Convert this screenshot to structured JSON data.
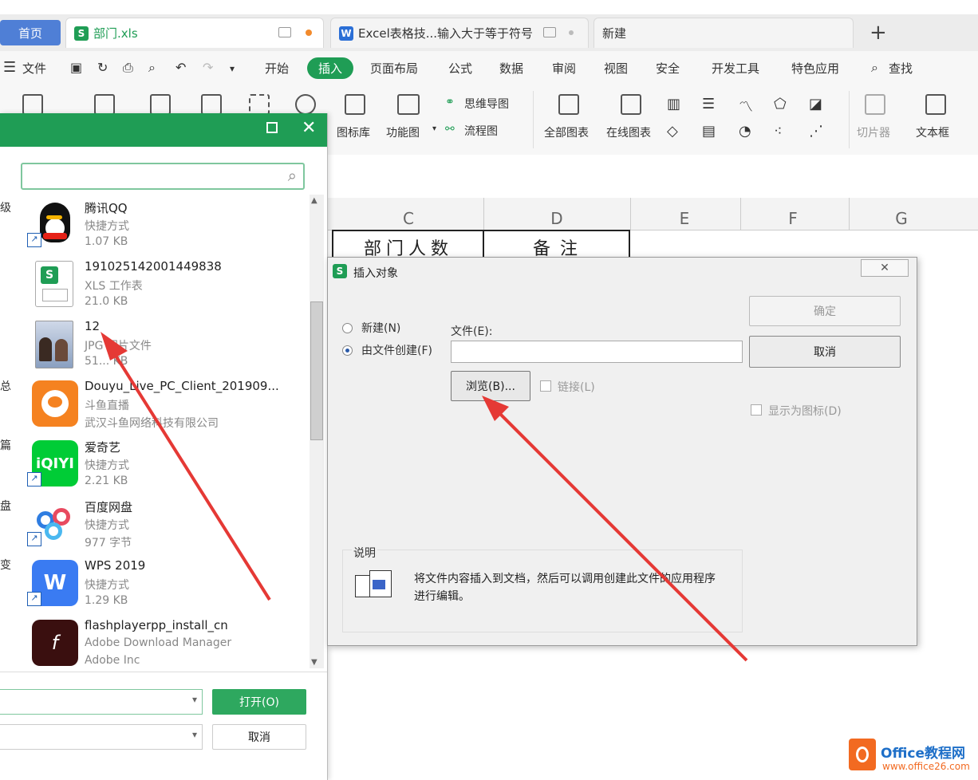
{
  "tabs": {
    "home": "首页",
    "file1": "部门.xls",
    "file2": "Excel表格技...输入大于等于符号",
    "new_tab": "新建",
    "plus": "+"
  },
  "menu": [
    "文件",
    "开始",
    "插入",
    "页面布局",
    "公式",
    "数据",
    "审阅",
    "视图",
    "安全",
    "开发工具",
    "特色应用",
    "查找"
  ],
  "ribbon": {
    "mind_map": "思维导图",
    "flow_chart": "流程图",
    "icon_lib": "图标库",
    "func_chart": "功能图",
    "all_charts": "全部图表",
    "online_charts": "在线图表",
    "slicer": "切片器",
    "textbox": "文本框"
  },
  "sheet": {
    "columns": [
      "C",
      "D",
      "E",
      "F",
      "G"
    ],
    "cells": {
      "c1": "部门人数",
      "d1": "备注"
    }
  },
  "file_dialog": {
    "left_labels": [
      "级",
      "总",
      "篇",
      "盘",
      "变"
    ],
    "items": [
      {
        "name": "腾讯QQ",
        "type": "快捷方式",
        "size": "1.07 KB",
        "icon": "qq-icon"
      },
      {
        "name": "191025142001449838",
        "type": "XLS 工作表",
        "size": "21.0 KB",
        "icon": "xls-icon"
      },
      {
        "name": "12",
        "type": "JPG 图片文件",
        "size": "51... KB",
        "icon": "jpg-thumbnail"
      },
      {
        "name": "Douyu_Live_PC_Client_201909...",
        "type": "斗鱼直播",
        "size": "武汉斗鱼网络科技有限公司",
        "icon": "douyu-icon"
      },
      {
        "name": "爱奇艺",
        "type": "快捷方式",
        "size": "2.21 KB",
        "icon": "iqiyi-icon"
      },
      {
        "name": "百度网盘",
        "type": "快捷方式",
        "size": "977 字节",
        "icon": "baidu-netdisk-icon"
      },
      {
        "name": "WPS 2019",
        "type": "快捷方式",
        "size": "1.29 KB",
        "icon": "wps-icon"
      },
      {
        "name": "flashplayerpp_install_cn",
        "type": "Adobe Download Manager",
        "size": "Adobe Inc",
        "icon": "flash-icon"
      }
    ],
    "open_button": "打开(O)",
    "cancel_button": "取消"
  },
  "insert_object": {
    "title": "插入对象",
    "radio_new": "新建(N)",
    "radio_from_file": "由文件创建(F)",
    "file_label": "文件(E):",
    "file_value": "",
    "browse_button": "浏览(B)...",
    "link_label": "链接(L)",
    "ok_button": "确定",
    "cancel_button": "取消",
    "show_as_icon": "显示为图标(D)",
    "desc_label": "说明",
    "desc_text": "将文件内容插入到文档，然后可以调用创建此文件的应用程序进行编辑。"
  },
  "watermark": {
    "brand": "Office教程网",
    "url": "www.office26.com"
  },
  "colors": {
    "green": "#1f9d55",
    "blue": "#4f7fd6",
    "arrow": "#e53935",
    "orange": "#f26a21"
  }
}
